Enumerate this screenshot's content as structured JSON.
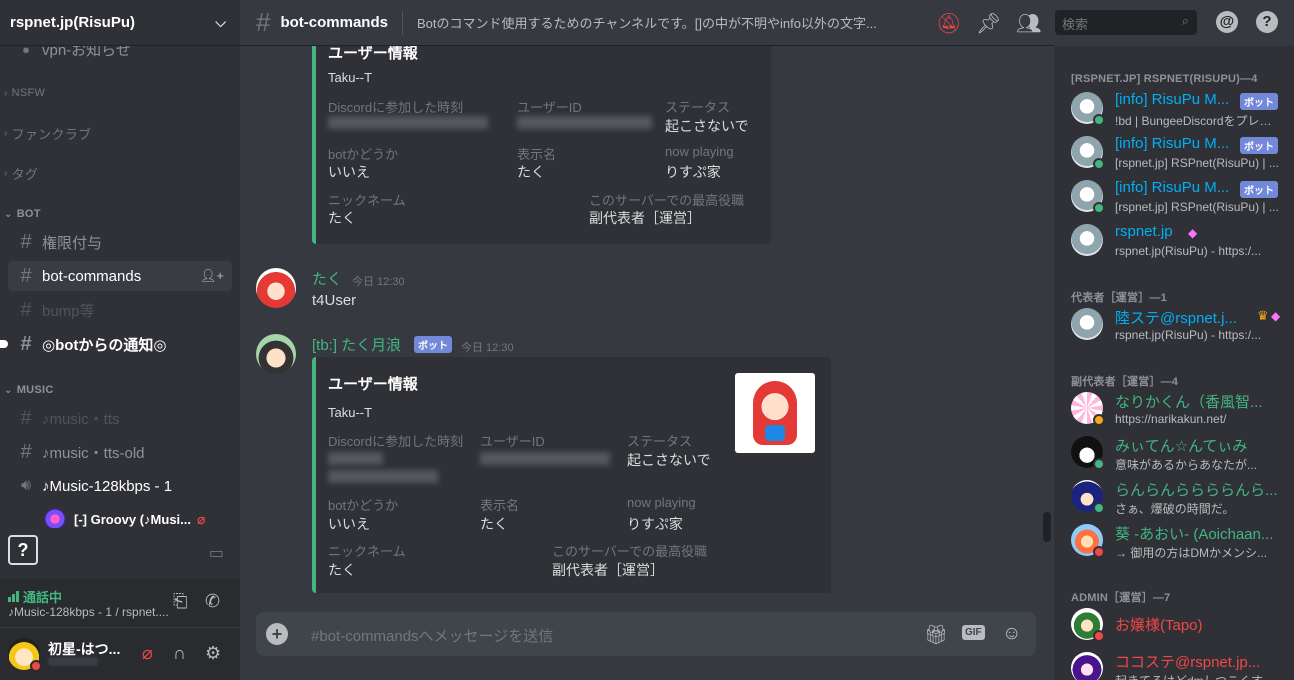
{
  "server": {
    "name": "rspnet.jp(RisuPu)"
  },
  "channels": {
    "partial_top": "vpn-お知らせ",
    "categories": {
      "nsfw": "NSFW",
      "fanclub": "ファンクラブ",
      "tag": "タグ",
      "bot": "BOT",
      "music": "MUSIC"
    },
    "bot": {
      "perm": "権限付与",
      "botcommands": "bot-commands",
      "bump": "bump等",
      "notify": "◎botからの通知◎"
    },
    "music": {
      "tts": "♪music・tts",
      "tts_old": "♪music・tts-old",
      "voice": "♪Music-128kbps - 1",
      "voice_user": "[-] Groovy (♪Musi..."
    }
  },
  "voice_panel": {
    "status": "通話中",
    "channel": "♪Music-128kbps - 1 / rspnet...."
  },
  "user": {
    "name": "初星-はつ..."
  },
  "topbar": {
    "channel": "bot-commands",
    "topic": "Botのコマンド使用するためのチャンネルです。[]の中が不明やinfo以外の文字...",
    "search_placeholder": "検索"
  },
  "messages": {
    "embed1": {
      "title": "ユーザー情報",
      "desc": "Taku--T",
      "f1_label": "Discordに参加した時刻",
      "f2_label": "ユーザーID",
      "f3_label": "ステータス",
      "f3_value": "起こさないで",
      "f4_label": "botかどうか",
      "f4_value": "いいえ",
      "f5_label": "表示名",
      "f5_value": "たく",
      "f6_label": "now playing",
      "f6_value": "りすぷ家",
      "f7_label": "ニックネーム",
      "f7_value": "たく",
      "f8_label": "このサーバーでの最高役職",
      "f8_value": "副代表者［運営］"
    },
    "msg1": {
      "author": "たく",
      "time": "今日 12:30",
      "text": "t4User"
    },
    "msg2": {
      "author": "[tb:] たく月浪",
      "badge": "ボット",
      "time": "今日 12:30"
    },
    "embed2": {
      "title": "ユーザー情報",
      "desc": "Taku--T",
      "f1_label": "Discordに参加した時刻",
      "f2_label": "ユーザーID",
      "f3_label": "ステータス",
      "f3_value": "起こさないで",
      "f4_label": "botかどうか",
      "f4_value": "いいえ",
      "f5_label": "表示名",
      "f5_value": "たく",
      "f6_label": "now playing",
      "f6_value": "りすぷ家",
      "f7_label": "ニックネーム",
      "f7_value": "たく",
      "f8_label": "このサーバーでの最高役職",
      "f8_value": "副代表者［運営］"
    }
  },
  "composer": {
    "placeholder": "#bot-commandsへメッセージを送信",
    "gif": "GIF"
  },
  "members": {
    "cat1": "[RSPNET.JP] RSPNET(RISUPU)—4",
    "m1": {
      "name": "[info] RisuPu M...",
      "badge": "ボット",
      "activity": "!bd | BungeeDiscordをプレイ中"
    },
    "m2": {
      "name": "[info] RisuPu M...",
      "badge": "ボット",
      "activity": "[rspnet.jp] RSPnet(RisuPu) | ..."
    },
    "m3": {
      "name": "[info] RisuPu M...",
      "badge": "ボット",
      "activity": "[rspnet.jp] RSPnet(RisuPu) | ..."
    },
    "m4": {
      "name": "rspnet.jp",
      "activity": "rspnet.jp(RisuPu) - https:/..."
    },
    "cat2": "代表者［運営］—1",
    "m5": {
      "name": "陸ステ@rspnet.j...",
      "activity": "rspnet.jp(RisuPu) - https:/..."
    },
    "cat3": "副代表者［運営］—4",
    "m6": {
      "name": "なりかくん（香風智...",
      "activity": "https://narikakun.net/"
    },
    "m7": {
      "name": "みぃてん☆んてぃみ",
      "activity": "意味があるからあなたが..."
    },
    "m8": {
      "name": "らんらんららららんら...",
      "activity": "さぁ、爆破の時間だ。"
    },
    "m9": {
      "name": "葵 -あおい- (Aoichaan...",
      "activity": "→ 御用の方はDMかメンシ..."
    },
    "cat4": "ADMIN［運営］—7",
    "m10": {
      "name": "お嬢様(Tapo)"
    },
    "m11": {
      "name": "ココステ@rspnet.jp...",
      "activity": "起きてるけどdmしつこくす..."
    }
  },
  "colors": {
    "online": "#43b581",
    "dnd": "#f04747",
    "blurple": "#7289da",
    "bot_name": "#00aff4",
    "admin": "#f04747"
  }
}
